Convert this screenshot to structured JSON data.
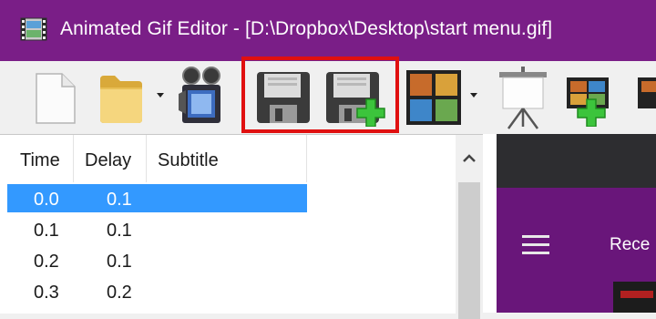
{
  "window": {
    "title": "Animated Gif Editor - [D:\\Dropbox\\Desktop\\start menu.gif]"
  },
  "toolbar": {
    "buttons": [
      {
        "name": "new",
        "icon": "new-document-icon"
      },
      {
        "name": "open",
        "icon": "folder-icon",
        "has_dropdown": true
      },
      {
        "name": "capture",
        "icon": "video-camera-icon"
      },
      {
        "name": "save",
        "icon": "floppy-disk-icon"
      },
      {
        "name": "save-as",
        "icon": "floppy-disk-plus-icon"
      },
      {
        "name": "frames",
        "icon": "film-strip-icon",
        "has_dropdown": true
      },
      {
        "name": "presentation",
        "icon": "projector-screen-icon"
      },
      {
        "name": "add-frames",
        "icon": "film-add-icon"
      }
    ],
    "highlight_color": "#e01010"
  },
  "list": {
    "columns": [
      "Time",
      "Delay",
      "Subtitle"
    ],
    "rows": [
      {
        "time": "0.0",
        "delay": "0.1",
        "subtitle": "",
        "selected": true
      },
      {
        "time": "0.1",
        "delay": "0.1",
        "subtitle": "",
        "selected": false
      },
      {
        "time": "0.2",
        "delay": "0.1",
        "subtitle": "",
        "selected": false
      },
      {
        "time": "0.3",
        "delay": "0.2",
        "subtitle": "",
        "selected": false
      }
    ]
  },
  "preview": {
    "text": "Rece"
  },
  "colors": {
    "titlebar": "#7a1e87",
    "selection": "#3399ff",
    "preview_dark": "#2d2d30",
    "preview_purple": "#69167a"
  }
}
